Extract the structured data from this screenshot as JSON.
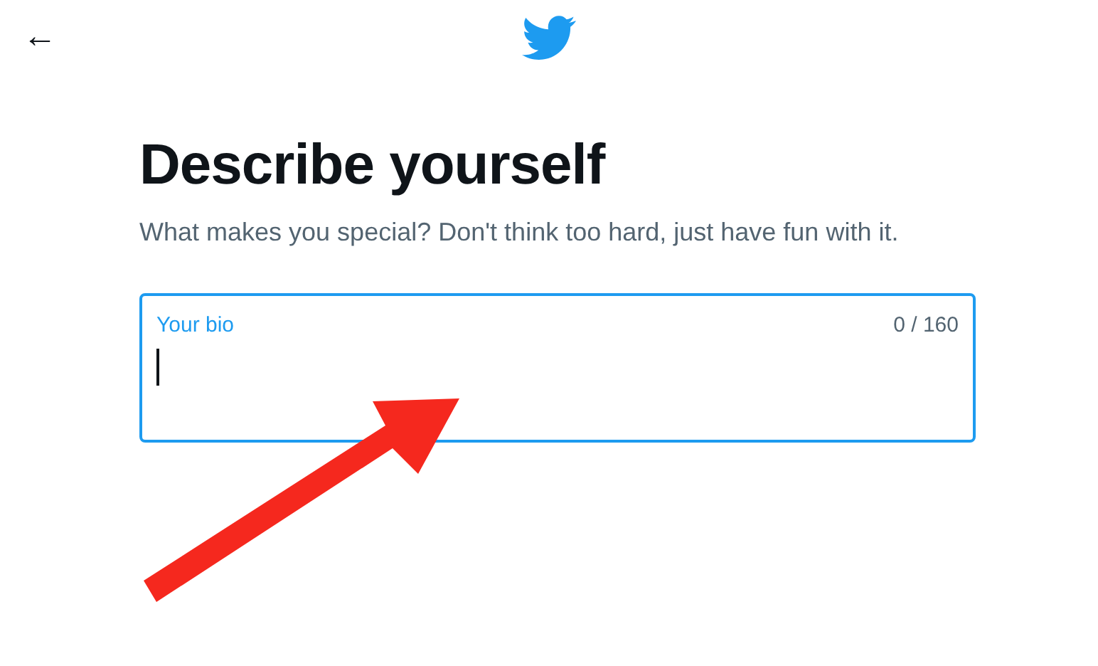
{
  "header": {
    "back": "←"
  },
  "title": "Describe yourself",
  "subtitle": "What makes you special? Don't think too hard, just have fun with it.",
  "bio_field": {
    "label": "Your bio",
    "counter": "0 / 160",
    "focused": true
  },
  "annotation": {
    "kind": "arrow"
  }
}
